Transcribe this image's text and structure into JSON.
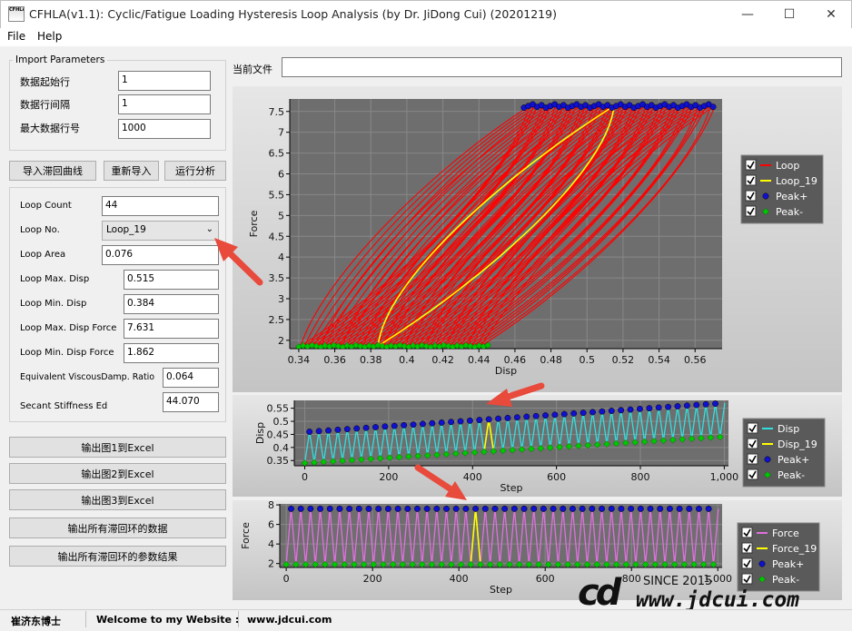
{
  "window": {
    "title": "CFHLA(v1.1): Cyclic/Fatigue Loading Hysteresis Loop Analysis (by Dr. JiDong Cui) (20201219)",
    "icon_text": "CFHLA",
    "minimize": "—",
    "maximize": "☐",
    "close": "✕"
  },
  "menu": {
    "file": "File",
    "help": "Help"
  },
  "import": {
    "title": "Import Parameters",
    "start_row_label": "数据起始行",
    "start_row": "1",
    "interval_label": "数据行间隔",
    "interval": "1",
    "max_row_label": "最大数据行号",
    "max_row": "1000"
  },
  "actions": {
    "import": "导入滞回曲线",
    "reimport": "重新导入",
    "analyze": "运行分析"
  },
  "results": {
    "loop_count_label": "Loop Count",
    "loop_count": "44",
    "loop_no_label": "Loop No.",
    "loop_no": "Loop_19",
    "loop_area_label": "Loop Area",
    "loop_area": "0.076",
    "max_disp_label": "Loop Max. Disp",
    "max_disp": "0.515",
    "min_disp_label": "Loop Min. Disp",
    "min_disp": "0.384",
    "max_force_label": "Loop Max. Disp Force",
    "max_force": "7.631",
    "min_force_label": "Loop Min. Disp Force",
    "min_force": "1.862",
    "damping_label": "Equivalent ViscousDamp. Ratio",
    "damping": "0.064",
    "stiffness_label": "Secant Stiffness Ed",
    "stiffness": "44.070"
  },
  "exports": [
    "输出图1到Excel",
    "输出图2到Excel",
    "输出图3到Excel",
    "输出所有滞回环的数据",
    "输出所有滞回环的参数结果"
  ],
  "current_file_label": "当前文件",
  "current_file": "",
  "status": {
    "author": "崔济东博士",
    "welcome": "Welcome to my Website :",
    "site": "www.jdcui.com"
  },
  "watermark": {
    "since": "SINCE 2015",
    "url": "www.jdcui.com"
  },
  "colors": {
    "loop": "#ff0000",
    "highlight": "#ffff00",
    "peak_plus": "#1010d0",
    "peak_minus": "#00c800",
    "disp": "#30e0e0",
    "force": "#e070e0",
    "arrow": "#e84a3c"
  },
  "chart_data": [
    {
      "type": "line",
      "title": "",
      "xlabel": "Disp",
      "ylabel": "Force",
      "xlim": [
        0.335,
        0.575
      ],
      "ylim": [
        1.8,
        7.8
      ],
      "x_ticks": [
        0.34,
        0.36,
        0.38,
        0.4,
        0.42,
        0.44,
        0.46,
        0.48,
        0.5,
        0.52,
        0.54,
        0.56
      ],
      "y_ticks": [
        2,
        2.5,
        3,
        3.5,
        4,
        4.5,
        5,
        5.5,
        6,
        6.5,
        7,
        7.5
      ],
      "legend": [
        "Loop",
        "Loop_19",
        "Peak+",
        "Peak-"
      ],
      "legend_position": "right",
      "loop_count": 44,
      "highlight_loop": {
        "name": "Loop_19",
        "min_disp": 0.384,
        "max_disp": 0.515,
        "min_force": 1.862,
        "max_force": 7.631
      },
      "peak_plus": {
        "x_range": [
          0.465,
          0.57
        ],
        "y": 7.63
      },
      "peak_minus": {
        "x_range": [
          0.34,
          0.445
        ],
        "y": 1.86
      }
    },
    {
      "type": "line",
      "title": "",
      "xlabel": "Step",
      "ylabel": "Disp",
      "xlim": [
        -25,
        1010
      ],
      "ylim": [
        0.33,
        0.58
      ],
      "x_ticks": [
        0,
        200,
        400,
        600,
        800,
        1000
      ],
      "x_tick_labels": [
        "0",
        "200",
        "400",
        "600",
        "800",
        "1,000"
      ],
      "y_ticks": [
        0.35,
        0.4,
        0.45,
        0.5,
        0.55
      ],
      "legend": [
        "Disp",
        "Disp_19",
        "Peak+",
        "Peak-"
      ],
      "legend_position": "right",
      "cycles": 44,
      "period": 22.5,
      "start": 0,
      "peak_plus_range": [
        0.46,
        0.57
      ],
      "peak_minus_range": [
        0.34,
        0.44
      ],
      "highlight_cycle": 19
    },
    {
      "type": "line",
      "title": "",
      "xlabel": "Step",
      "ylabel": "Force",
      "xlim": [
        -15,
        1010
      ],
      "ylim": [
        1.6,
        8.1
      ],
      "x_ticks": [
        0,
        200,
        400,
        600,
        800,
        1000
      ],
      "x_tick_labels": [
        "0",
        "200",
        "400",
        "600",
        "800",
        "1,000"
      ],
      "y_ticks": [
        2,
        4,
        6,
        8
      ],
      "legend": [
        "Force",
        "Force_19",
        "Peak+",
        "Peak-"
      ],
      "legend_position": "right",
      "cycles": 44,
      "period": 22.5,
      "start": 0,
      "peak_plus_value": 7.6,
      "peak_minus_value": 1.9,
      "highlight_cycle": 19
    }
  ]
}
